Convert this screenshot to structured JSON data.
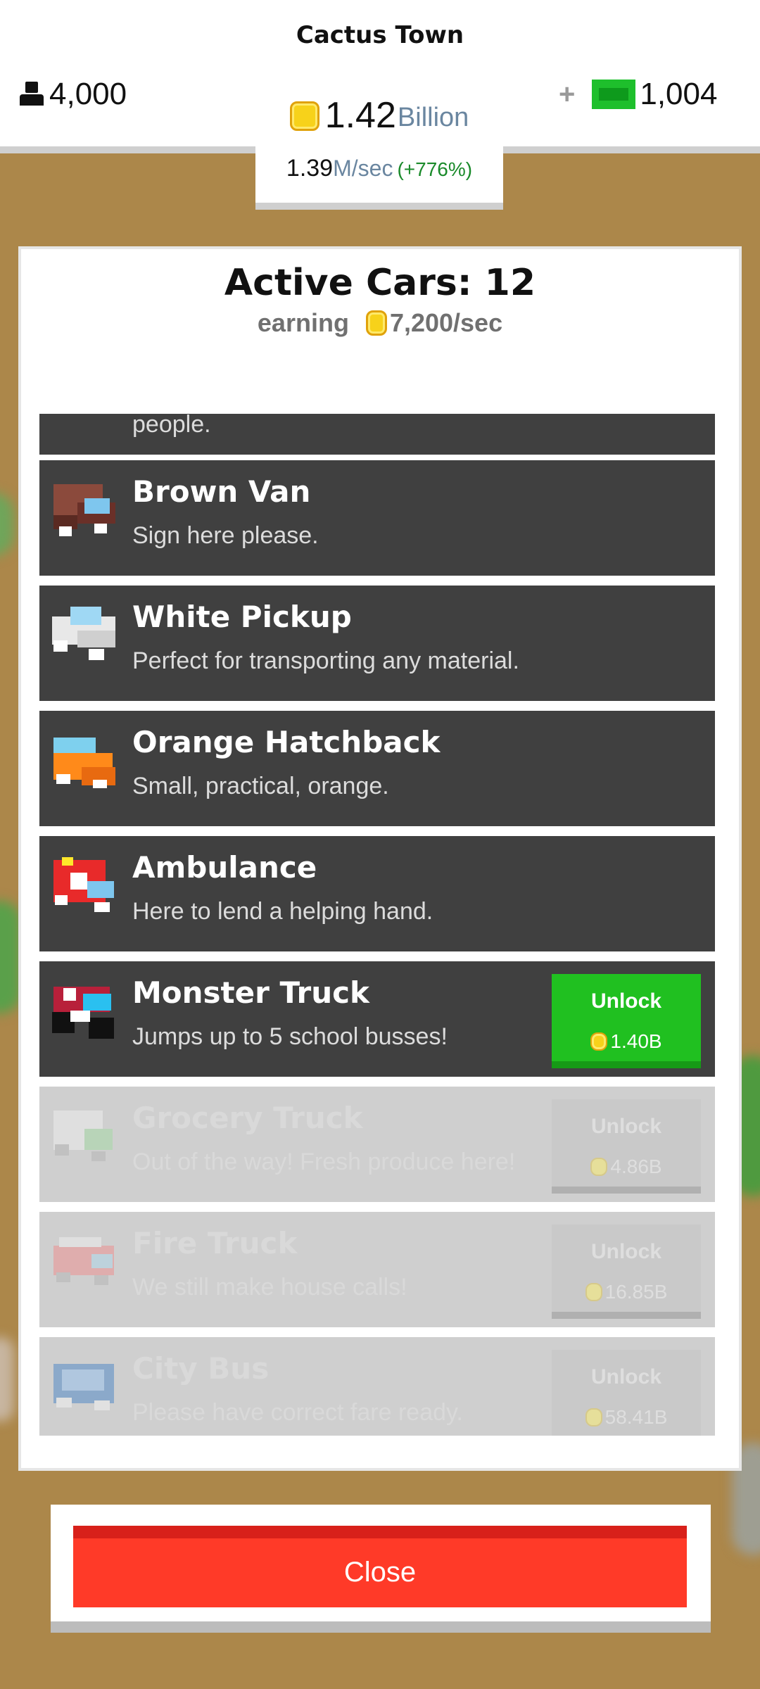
{
  "header": {
    "town_name": "Cactus Town",
    "population": "4,000",
    "gold_value": "1.42",
    "gold_unit": "Billion",
    "rate_value": "1.39",
    "rate_unit": "M/sec",
    "rate_percent": "(+776%)",
    "cash_plus": "+",
    "cash_value": "1,004"
  },
  "panel": {
    "title": "Active Cars: 12",
    "subtitle_prefix": "earning",
    "subtitle_rate": "7,200/sec",
    "partial_row_desc": "people.",
    "cars": [
      {
        "name": "Brown Van",
        "desc": "Sign here please.",
        "icon": "brown-van-icon"
      },
      {
        "name": "White Pickup",
        "desc": "Perfect for transporting any material.",
        "icon": "white-pickup-icon"
      },
      {
        "name": "Orange Hatchback",
        "desc": "Small, practical, orange.",
        "icon": "orange-hatchback-icon"
      },
      {
        "name": "Ambulance",
        "desc": "Here to lend a helping hand.",
        "icon": "ambulance-icon"
      },
      {
        "name": "Monster Truck",
        "desc": "Jumps up to 5 school busses!",
        "icon": "monster-truck-icon",
        "unlock_label": "Unlock",
        "unlock_cost": "1.40B"
      },
      {
        "name": "Grocery Truck",
        "desc": "Out of the way! Fresh produce here!",
        "icon": "grocery-truck-icon",
        "unlock_label": "Unlock",
        "unlock_cost": "4.86B",
        "locked": true
      },
      {
        "name": "Fire Truck",
        "desc": "We still make house calls!",
        "icon": "fire-truck-icon",
        "unlock_label": "Unlock",
        "unlock_cost": "16.85B",
        "locked": true
      },
      {
        "name": "City Bus",
        "desc": "Please have correct fare ready.",
        "icon": "city-bus-icon",
        "unlock_label": "Unlock",
        "unlock_cost": "58.41B",
        "locked": true
      }
    ]
  },
  "close_label": "Close",
  "colors": {
    "unlock_green": "#20c020",
    "close_red": "#ff3a28",
    "row_dark": "#404040",
    "coin_gold": "#f7d21a"
  }
}
